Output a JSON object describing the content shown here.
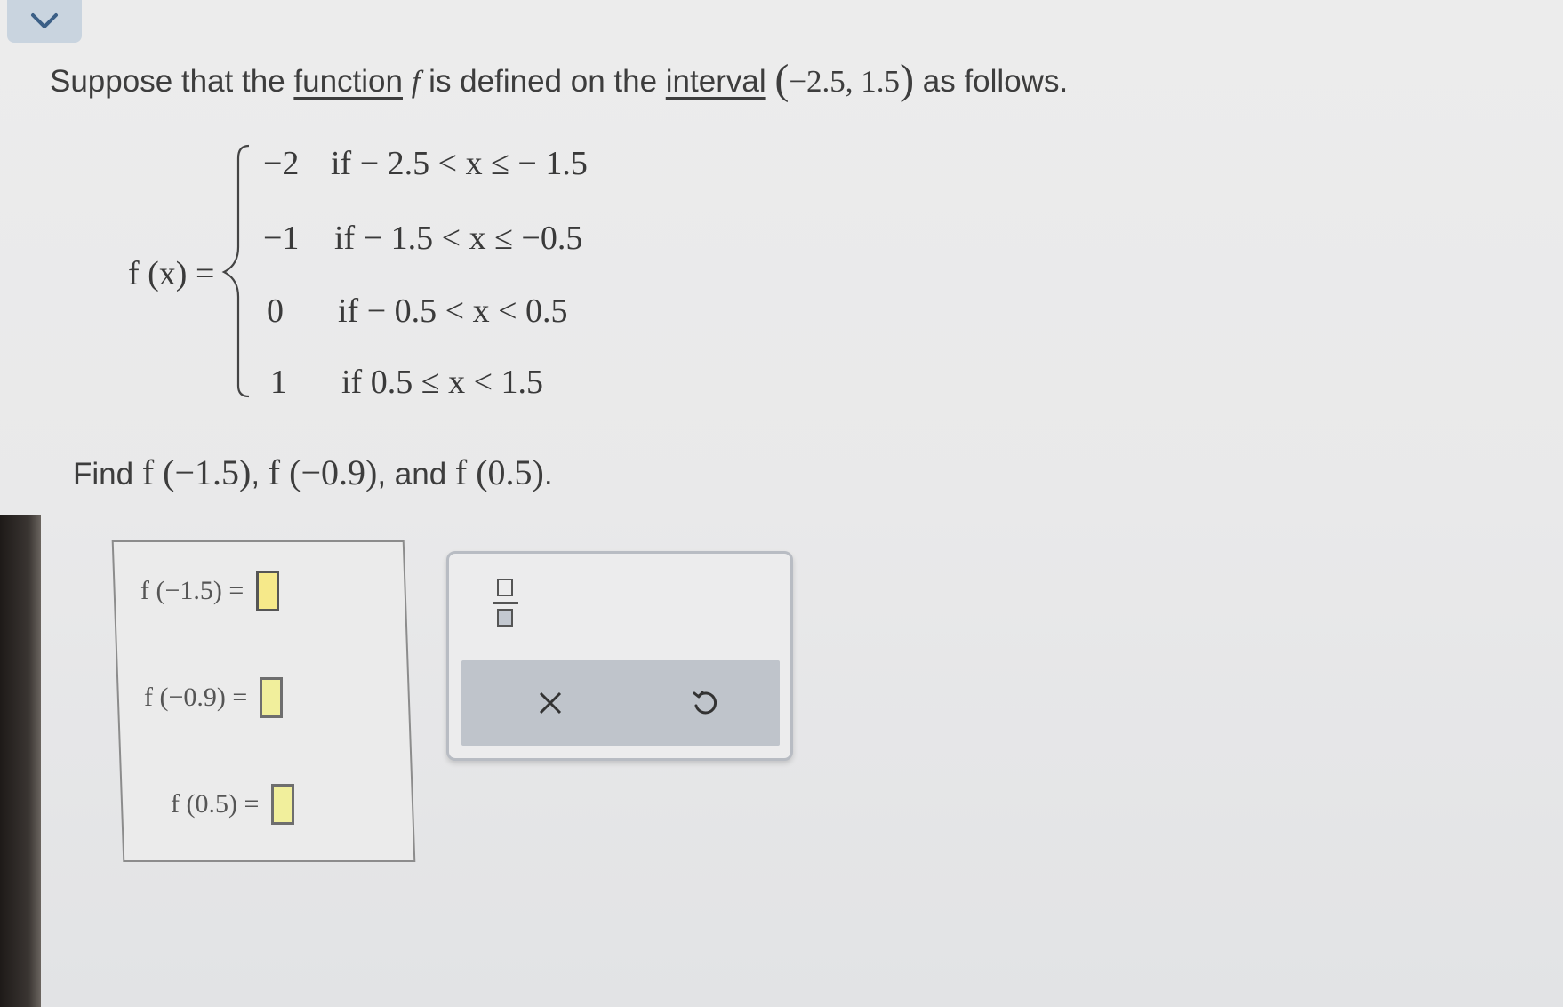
{
  "intro": {
    "part1": "Suppose that the ",
    "link_function": "function",
    "part2": " ",
    "fvar": "f",
    "part3": " is defined on the ",
    "link_interval": "interval",
    "interval": "−2.5,   1.5",
    "part4": " as follows."
  },
  "definition": {
    "label": "f (x) = ",
    "pieces": [
      {
        "value": "−2",
        "condition": "if  − 2.5 < x ≤ − 1.5"
      },
      {
        "value": "−1",
        "condition": "if  − 1.5 < x ≤ −0.5"
      },
      {
        "value": "0",
        "condition": "if  − 0.5 < x < 0.5"
      },
      {
        "value": "1",
        "condition": "if 0.5 ≤ x < 1.5"
      }
    ]
  },
  "question": {
    "find": "Find ",
    "e1": "f (−1.5)",
    "sep": ", ",
    "e2": "f (−0.9)",
    "and": ", and ",
    "e3": "f (0.5)",
    "end": "."
  },
  "answers": [
    {
      "label": "f (−1.5) = ",
      "value": ""
    },
    {
      "label": "f (−0.9) = ",
      "value": ""
    },
    {
      "label": "f (0.5) = ",
      "value": ""
    }
  ],
  "tools": {
    "fraction_icon": "fraction-icon",
    "clear_icon": "close-icon",
    "undo_icon": "undo-icon"
  },
  "colors": {
    "collapse_button": "#c9d4df",
    "answer_slot": "#f1ef9c",
    "tool_bar": "#bfc4cb"
  }
}
